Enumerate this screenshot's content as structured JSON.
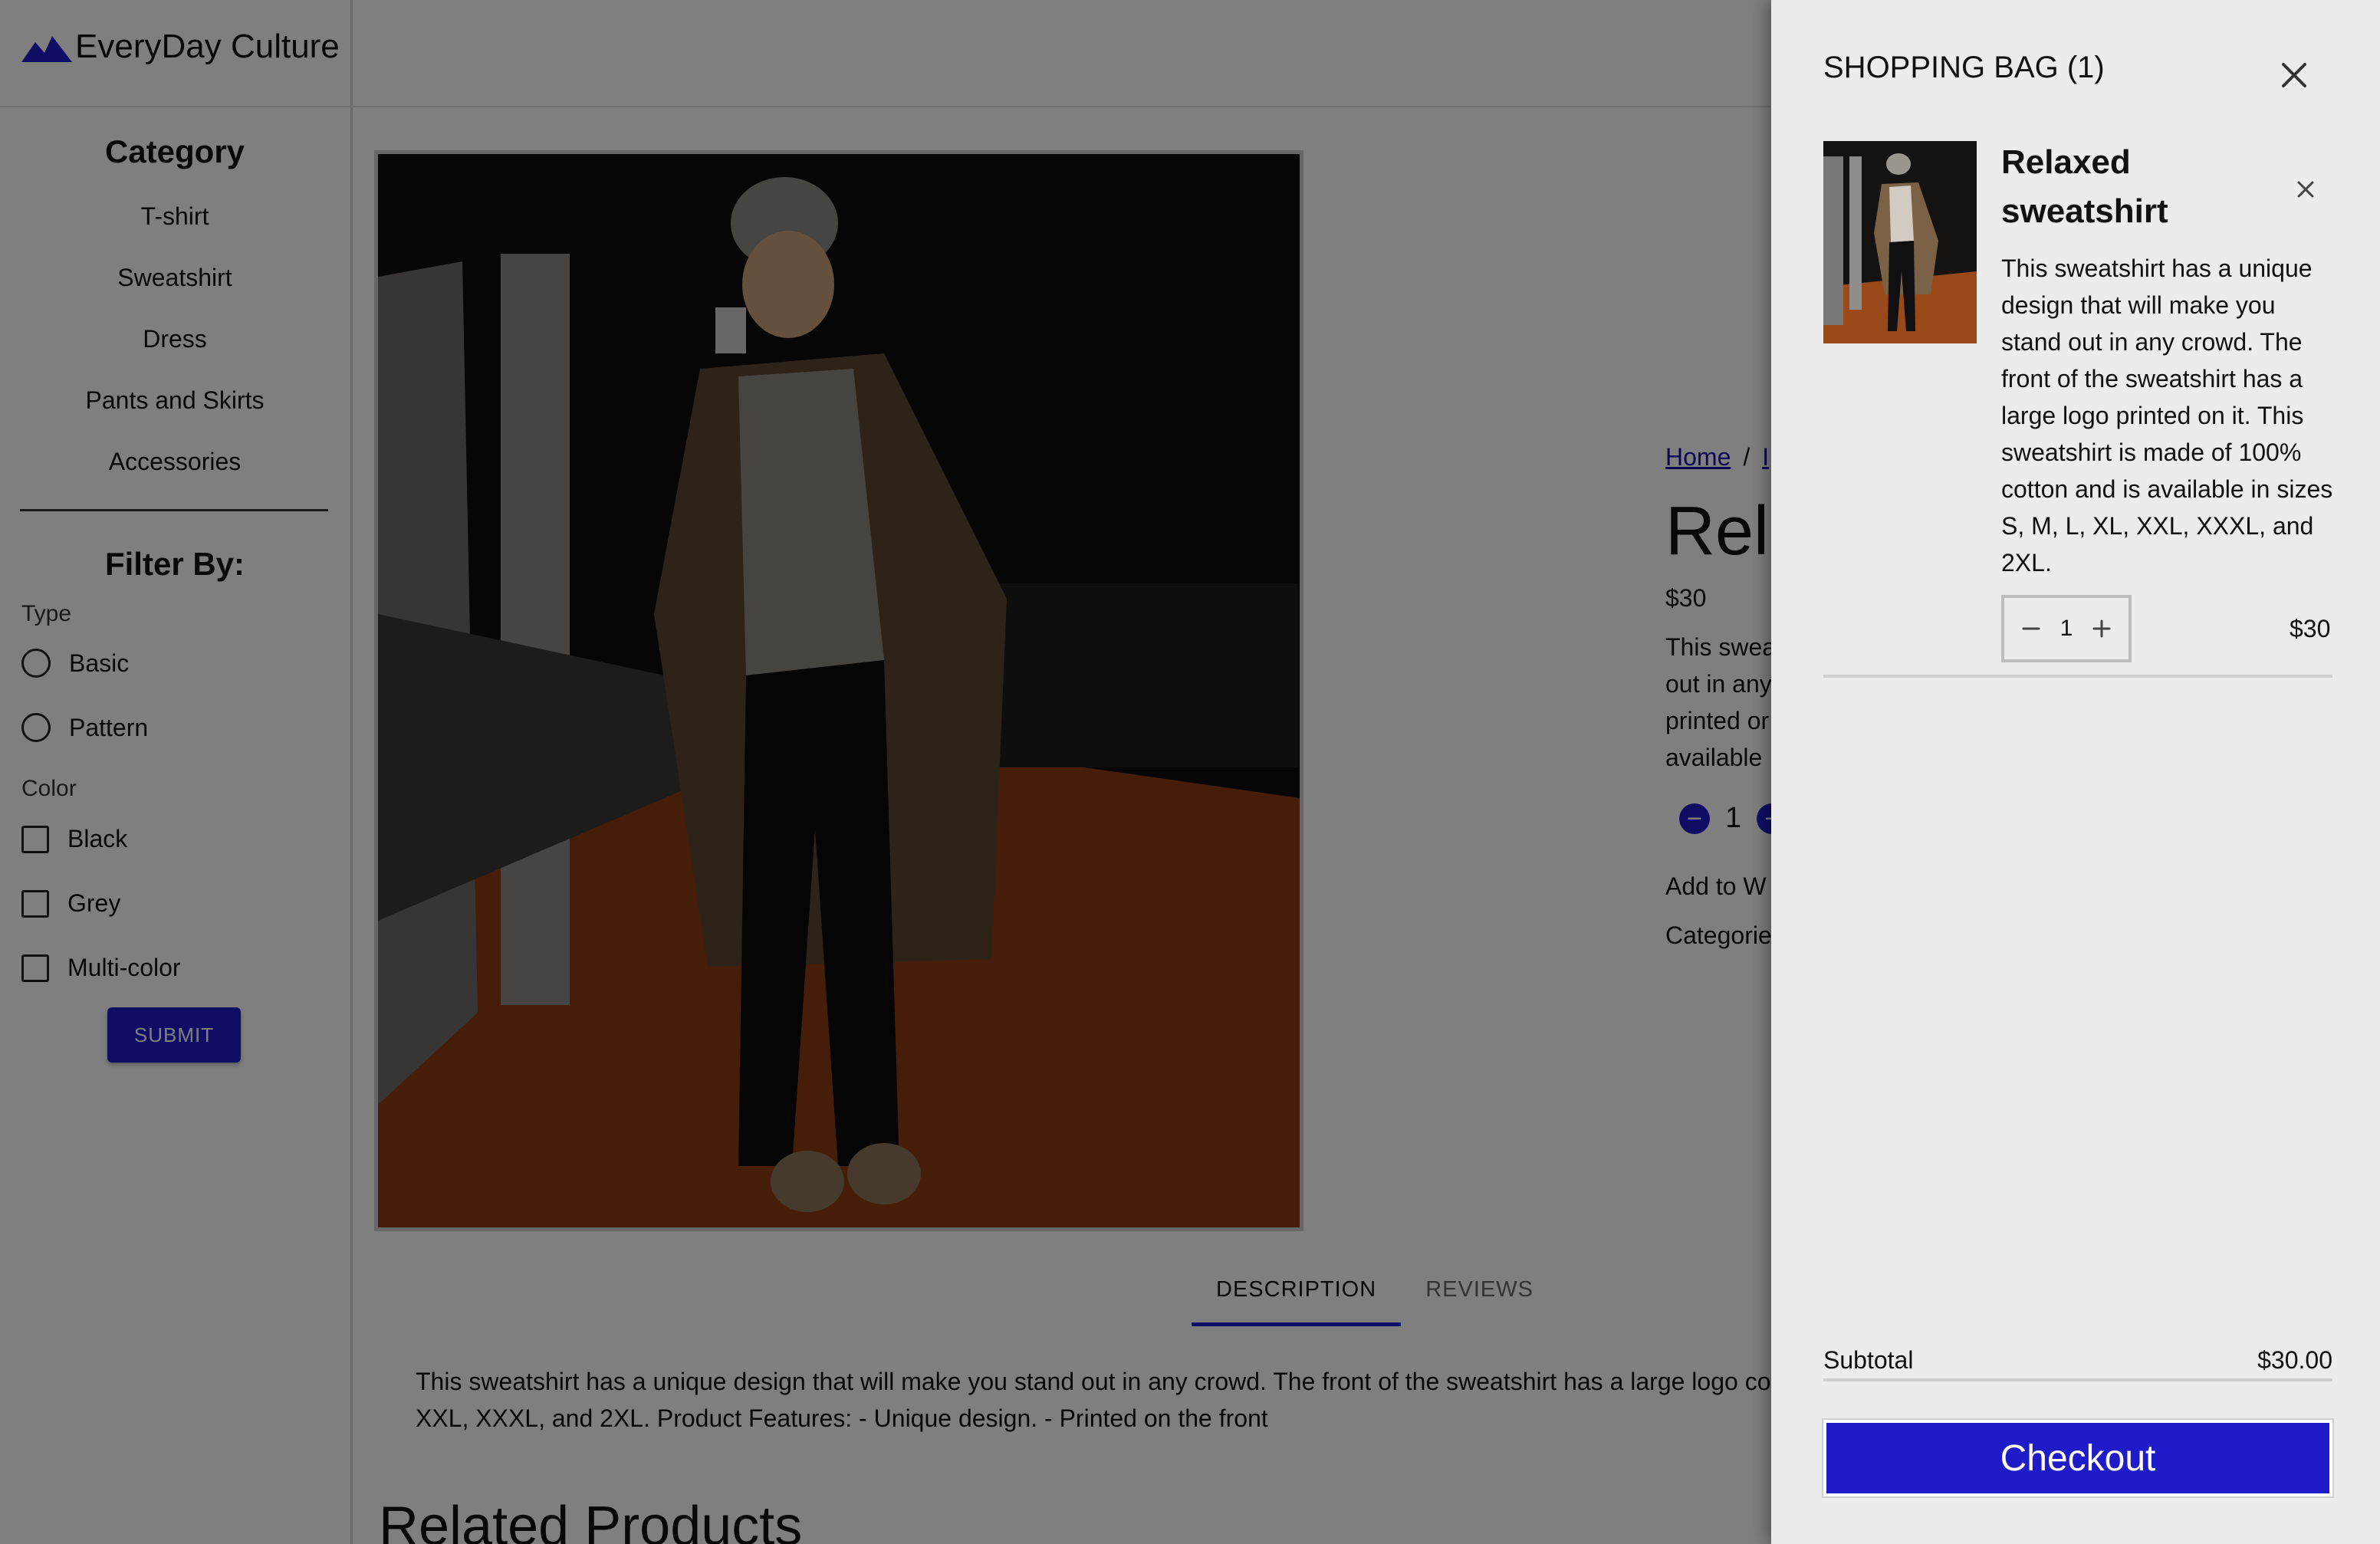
{
  "brand": {
    "name": "EveryDay Culture",
    "logo_color": "#1f1bc9"
  },
  "sidebar": {
    "category_title": "Category",
    "categories": [
      "T-shirt",
      "Sweatshirt",
      "Dress",
      "Pants and Skirts",
      "Accessories"
    ],
    "filter_title": "Filter By:",
    "type_label": "Type",
    "type_options": [
      "Basic",
      "Pattern"
    ],
    "color_label": "Color",
    "color_options": [
      "Black",
      "Grey",
      "Multi-color"
    ],
    "submit_label": "SUBMIT"
  },
  "product": {
    "breadcrumb": [
      "Home",
      "/",
      "I"
    ],
    "title": "Rela",
    "price": "$30",
    "desc_lines": [
      "This swea",
      "out in any",
      "printed or",
      "available"
    ],
    "qty": "1",
    "wishlist": "Add to W",
    "categories": "Categorie"
  },
  "tabs": [
    "DESCRIPTION",
    "REVIEWS"
  ],
  "description": "This sweatshirt has a unique design that will make you stand out in any crowd. The front of the sweatshirt has a large logo cotton and is available in sizes S, M, L, XL, XXL, XXXL, and 2XL. Product Features: - Unique design. - Printed on the front",
  "related_title": "Related Products",
  "cart": {
    "title": "SHOPPING BAG (1)",
    "item": {
      "name": "Relaxed sweatshirt",
      "description": "This sweatshirt has a unique design that will make you stand out in any crowd. The front of the sweatshirt has a large logo printed on it. This sweatshirt is made of 100% cotton and is available in sizes S, M, L, XL, XXL, XXXL, and 2XL.",
      "qty": "1",
      "price": "$30"
    },
    "subtotal_label": "Subtotal",
    "subtotal_value": "$30.00",
    "checkout_label": "Checkout"
  },
  "colors": {
    "accent": "#1f1bc9",
    "drawer_bg": "#ececec"
  },
  "icons": [
    "mountain-logo-icon",
    "close-icon",
    "remove-item-icon",
    "minus-icon",
    "plus-icon"
  ]
}
